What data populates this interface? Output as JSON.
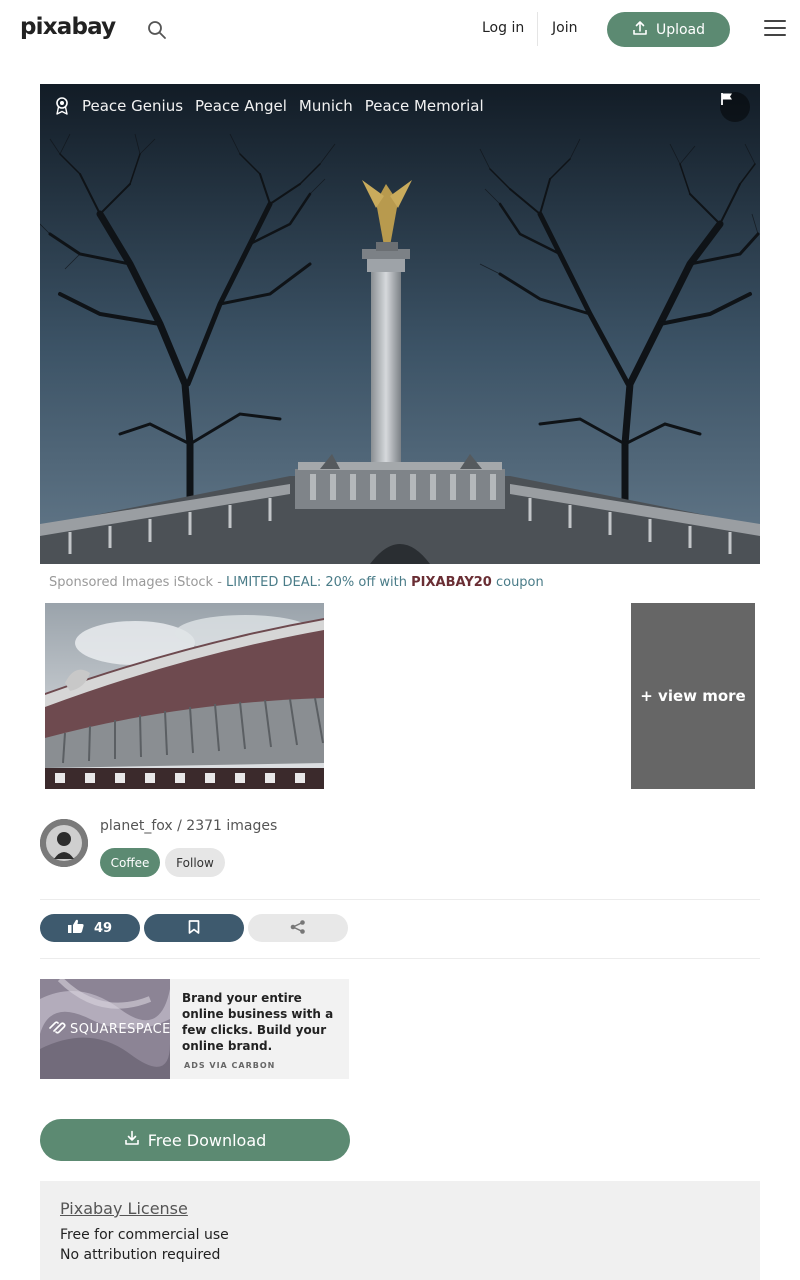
{
  "header": {
    "logo": "pixabay",
    "login_label": "Log in",
    "join_label": "Join",
    "upload_label": "Upload"
  },
  "image": {
    "tags": [
      "Peace Genius",
      "Peace Angel",
      "Munich",
      "Peace Memorial"
    ]
  },
  "sponsored": {
    "prefix": "Sponsored Images iStock -",
    "deal": "LIMITED DEAL: 20% off with",
    "code": "PIXABAY20",
    "suffix": "coupon",
    "view_more": "+ view more"
  },
  "user": {
    "info": "planet_fox / 2371 images",
    "coffee_label": "Coffee",
    "follow_label": "Follow"
  },
  "actions": {
    "like_count": "49"
  },
  "ad": {
    "brand": "SQUARESPACE",
    "text": "Brand your entire online business with a few clicks. Build your online brand.",
    "via": "ADS VIA CARBON"
  },
  "download": {
    "label": "Free Download"
  },
  "license": {
    "title": "Pixabay License",
    "line1": "Free for commercial use",
    "line2": "No attribution required"
  },
  "colors": {
    "accent": "#5c8a72",
    "action_dark": "#3e5a6e",
    "coupon": "#6a2e34"
  }
}
